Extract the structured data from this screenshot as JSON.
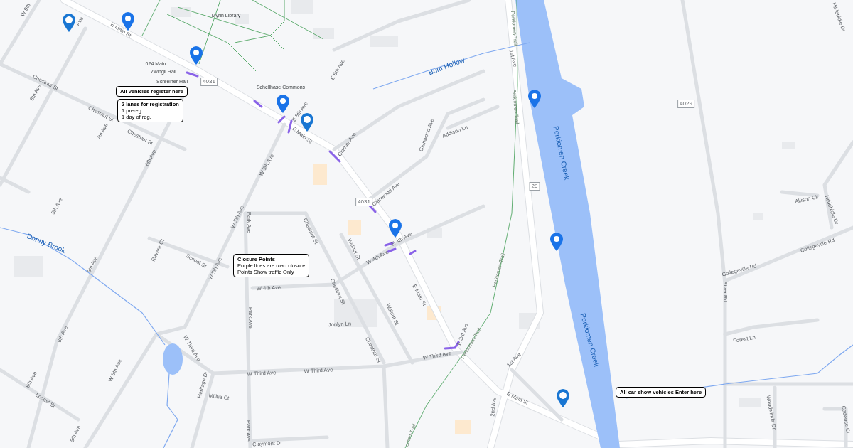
{
  "map": {
    "callouts": [
      {
        "title": "All vehicles register here"
      },
      {
        "title": "2 lanes for registration",
        "lines": [
          "1 prereg.",
          "1 day of reg."
        ]
      },
      {
        "title": "Closure Points",
        "lines": [
          "Purple lines are road closure",
          "Points Show traffic Only"
        ]
      },
      {
        "title": "All car show vehicles Enter here"
      }
    ],
    "labels": [
      {
        "text": "W 9th",
        "kind": "street"
      },
      {
        "text": "Ave",
        "kind": "street"
      },
      {
        "text": "E Main St",
        "kind": "street"
      },
      {
        "text": "Myrin Library",
        "kind": "place"
      },
      {
        "text": "624 Main",
        "kind": "place"
      },
      {
        "text": "Zwingli Hall",
        "kind": "place"
      },
      {
        "text": "Schreiner Hall",
        "kind": "place"
      },
      {
        "text": "4031",
        "kind": "shield"
      },
      {
        "text": "Schellhase Commons",
        "kind": "place"
      },
      {
        "text": "E 5th Ave",
        "kind": "street"
      },
      {
        "text": "E Main St",
        "kind": "street"
      },
      {
        "text": "Chestnut St",
        "kind": "street"
      },
      {
        "text": "8th Ave",
        "kind": "street"
      },
      {
        "text": "Chestnut St",
        "kind": "street"
      },
      {
        "text": "7th Ave",
        "kind": "street"
      },
      {
        "text": "Chestnut St",
        "kind": "street"
      },
      {
        "text": "6th Ave",
        "kind": "street"
      },
      {
        "text": "5th Ave",
        "kind": "street"
      },
      {
        "text": "W 5th Ave",
        "kind": "street"
      },
      {
        "text": "Park Ave",
        "kind": "street"
      },
      {
        "text": "E 5th Ave",
        "kind": "street"
      },
      {
        "text": "Bum Hollow",
        "kind": "water"
      },
      {
        "text": "1st Ave",
        "kind": "street"
      },
      {
        "text": "Perkiomen-Trail",
        "kind": "trail"
      },
      {
        "text": "Perkiomen-Trail",
        "kind": "trail"
      },
      {
        "text": "Clamer Ave",
        "kind": "street"
      },
      {
        "text": "Glenwood Ave",
        "kind": "street"
      },
      {
        "text": "Addison Ln",
        "kind": "street"
      },
      {
        "text": "Glenwood Ave",
        "kind": "street"
      },
      {
        "text": "4031",
        "kind": "shield"
      },
      {
        "text": "Perkiomen Creek",
        "kind": "water"
      },
      {
        "text": "29",
        "kind": "shield"
      },
      {
        "text": "4029",
        "kind": "shield"
      },
      {
        "text": "Hildebidle Dr",
        "kind": "street"
      },
      {
        "text": "Allison Cir",
        "kind": "street"
      },
      {
        "text": "Hildebidle Dr",
        "kind": "street"
      },
      {
        "text": "Collegeville Rd",
        "kind": "street"
      },
      {
        "text": "Collegeville Rd",
        "kind": "street"
      },
      {
        "text": "River Rd",
        "kind": "street"
      },
      {
        "text": "Forest Ln",
        "kind": "street"
      },
      {
        "text": "Woodwinds Dr",
        "kind": "street"
      },
      {
        "text": "Cadence Ct",
        "kind": "street"
      },
      {
        "text": "Perkiomen-Trail",
        "kind": "trail"
      },
      {
        "text": "Donny Brook",
        "kind": "water"
      },
      {
        "text": "6th Ave",
        "kind": "street"
      },
      {
        "text": "Revere Ct",
        "kind": "street"
      },
      {
        "text": "School St",
        "kind": "street"
      },
      {
        "text": "W 5th Ave",
        "kind": "street"
      },
      {
        "text": "W 5th Ave",
        "kind": "street"
      },
      {
        "text": "Chestnut St",
        "kind": "street"
      },
      {
        "text": "Walnut St",
        "kind": "street"
      },
      {
        "text": "E 4th Ave",
        "kind": "street"
      },
      {
        "text": "W 4th Ave",
        "kind": "street"
      },
      {
        "text": "W 4th Ave",
        "kind": "street"
      },
      {
        "text": "Park Ave",
        "kind": "street"
      },
      {
        "text": "Chestnut St",
        "kind": "street"
      },
      {
        "text": "E Main St",
        "kind": "street"
      },
      {
        "text": "Walnut St",
        "kind": "street"
      },
      {
        "text": "Jonlyn Ln",
        "kind": "street"
      },
      {
        "text": "6th Ave",
        "kind": "street"
      },
      {
        "text": "W Third Ave",
        "kind": "street"
      },
      {
        "text": "Chestnut St",
        "kind": "street"
      },
      {
        "text": "W 5th Ave",
        "kind": "street"
      },
      {
        "text": "Heritage Dr",
        "kind": "street"
      },
      {
        "text": "Militia Ct",
        "kind": "street"
      },
      {
        "text": "W Third Ave",
        "kind": "street"
      },
      {
        "text": "W Third Ave",
        "kind": "street"
      },
      {
        "text": "W Third Ave",
        "kind": "street"
      },
      {
        "text": "E 3rd Ave",
        "kind": "street"
      },
      {
        "text": "Perkiomen-Trail",
        "kind": "trail"
      },
      {
        "text": "1st Ave",
        "kind": "street"
      },
      {
        "text": "Perkiomen Creek",
        "kind": "water"
      },
      {
        "text": "2nd Ave",
        "kind": "street"
      },
      {
        "text": "E Main St",
        "kind": "street"
      },
      {
        "text": "8th Ave",
        "kind": "street"
      },
      {
        "text": "Locust St",
        "kind": "street"
      },
      {
        "text": "Park Ave",
        "kind": "street"
      },
      {
        "text": "Claymont Dr",
        "kind": "street"
      },
      {
        "text": "5th Ave",
        "kind": "street"
      },
      {
        "text": "omen-Trail",
        "kind": "trail"
      }
    ]
  }
}
